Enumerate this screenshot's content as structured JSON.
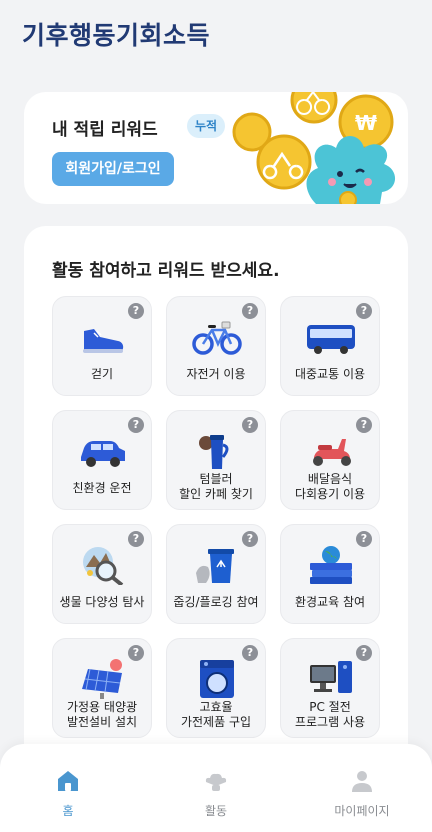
{
  "app": {
    "logo_text": "기후행동기회소득"
  },
  "reward": {
    "title": "내 적립 리워드",
    "badge": "누적",
    "login_label": "회원가입/로그인"
  },
  "activities": {
    "title": "활동 참여하고 리워드 받으세요.",
    "help_symbol": "?",
    "items": [
      {
        "line1": "걷기",
        "line2": "",
        "icon": "shoe-icon"
      },
      {
        "line1": "자전거 이용",
        "line2": "",
        "icon": "bicycle-icon"
      },
      {
        "line1": "대중교통 이용",
        "line2": "",
        "icon": "bus-icon"
      },
      {
        "line1": "친환경 운전",
        "line2": "",
        "icon": "car-icon"
      },
      {
        "line1": "텀블러",
        "line2": "할인 카페 찾기",
        "icon": "tumbler-icon"
      },
      {
        "line1": "배달음식",
        "line2": "다회용기 이용",
        "icon": "scooter-icon"
      },
      {
        "line1": "생물 다양성 탐사",
        "line2": "",
        "icon": "magnifier-globe-icon"
      },
      {
        "line1": "줍깅/플로깅 참여",
        "line2": "",
        "icon": "recycle-bin-icon"
      },
      {
        "line1": "환경교육 참여",
        "line2": "",
        "icon": "books-globe-icon"
      },
      {
        "line1": "가정용 태양광",
        "line2": "발전설비 설치",
        "icon": "solar-panel-icon"
      },
      {
        "line1": "고효율",
        "line2": "가전제품 구입",
        "icon": "washing-machine-icon"
      },
      {
        "line1": "PC 절전",
        "line2": "프로그램 사용",
        "icon": "computer-icon"
      }
    ]
  },
  "tabs": [
    {
      "label": "홈",
      "icon": "home-icon",
      "active": true
    },
    {
      "label": "활동",
      "icon": "activity-icon",
      "active": false
    },
    {
      "label": "마이페이지",
      "icon": "person-icon",
      "active": false
    }
  ],
  "colors": {
    "accent": "#5aa9e6",
    "brand": "#213a74",
    "active_tab": "#4a96cf"
  }
}
